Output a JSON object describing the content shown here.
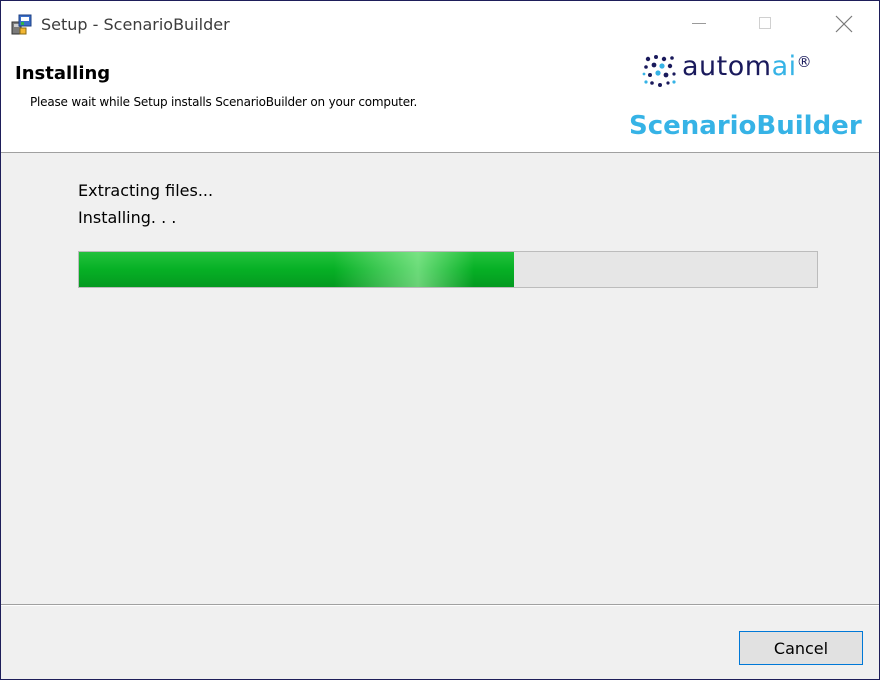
{
  "window": {
    "title": "Setup - ScenarioBuilder",
    "controls": {
      "minimize_icon": "minimize-icon",
      "maximize_icon": "maximize-icon",
      "close_icon": "close-icon"
    }
  },
  "header": {
    "title": "Installing",
    "subtitle": "Please wait while Setup installs ScenarioBuilder on your computer.",
    "logo": {
      "brand_prefix": "autom",
      "brand_suffix": "ai",
      "registered": "®",
      "product": "ScenarioBuilder",
      "brand_color": "#1a1a5c",
      "accent_color": "#36b3e6"
    }
  },
  "content": {
    "status_line_1": "Extracting files...",
    "status_line_2": "Installing. . .",
    "progress_fraction": 0.59,
    "progress_color": "#06b025"
  },
  "footer": {
    "cancel_label": "Cancel"
  }
}
